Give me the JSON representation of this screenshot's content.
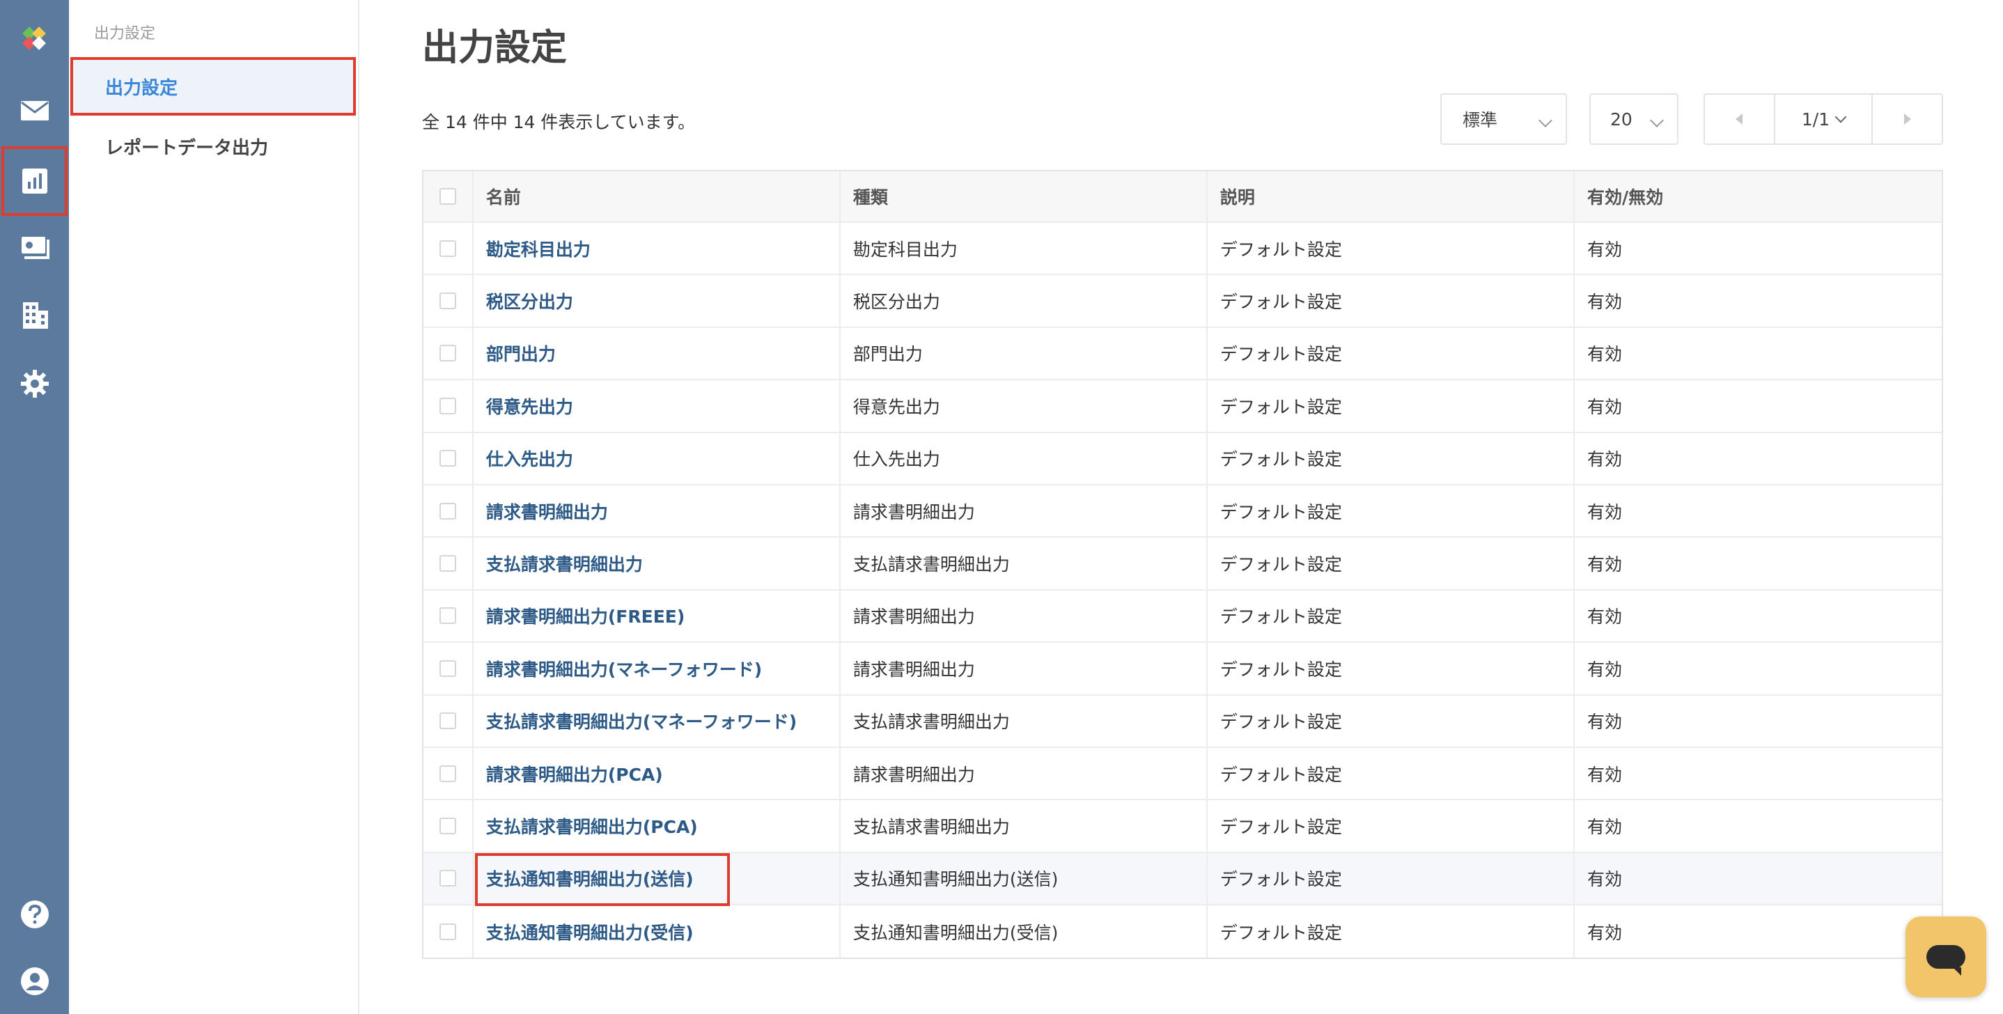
{
  "colors": {
    "rail": "#5b7a9d",
    "accent": "#3a86d8",
    "highlight_border": "#e03c2e",
    "link": "#2d5a86",
    "chat": "#f3c56a"
  },
  "rail": {
    "items": [
      {
        "name": "logo",
        "icon": "app-logo-icon"
      },
      {
        "name": "mail",
        "icon": "mail-icon"
      },
      {
        "name": "reports",
        "icon": "chart-icon",
        "selected": true
      },
      {
        "name": "documents",
        "icon": "document-icon"
      },
      {
        "name": "company",
        "icon": "building-icon"
      },
      {
        "name": "settings",
        "icon": "gear-icon"
      },
      {
        "name": "help",
        "icon": "help-icon"
      },
      {
        "name": "account",
        "icon": "user-icon"
      }
    ]
  },
  "subnav": {
    "title": "出力設定",
    "items": [
      {
        "label": "出力設定",
        "active": true
      },
      {
        "label": "レポートデータ出力",
        "active": false
      }
    ]
  },
  "main": {
    "title": "出力設定",
    "count_text": "全 14 件中 14 件表示しています。",
    "view_select": "標準",
    "per_page_select": "20",
    "pager_label": "1/1"
  },
  "table": {
    "headers": [
      "名前",
      "種類",
      "説明",
      "有効/無効"
    ],
    "rows": [
      {
        "name": "勘定科目出力",
        "type": "勘定科目出力",
        "desc": "デフォルト設定",
        "status": "有効"
      },
      {
        "name": "税区分出力",
        "type": "税区分出力",
        "desc": "デフォルト設定",
        "status": "有効"
      },
      {
        "name": "部門出力",
        "type": "部門出力",
        "desc": "デフォルト設定",
        "status": "有効"
      },
      {
        "name": "得意先出力",
        "type": "得意先出力",
        "desc": "デフォルト設定",
        "status": "有効"
      },
      {
        "name": "仕入先出力",
        "type": "仕入先出力",
        "desc": "デフォルト設定",
        "status": "有効"
      },
      {
        "name": "請求書明細出力",
        "type": "請求書明細出力",
        "desc": "デフォルト設定",
        "status": "有効"
      },
      {
        "name": "支払請求書明細出力",
        "type": "支払請求書明細出力",
        "desc": "デフォルト設定",
        "status": "有効"
      },
      {
        "name": "請求書明細出力(FREEE)",
        "type": "請求書明細出力",
        "desc": "デフォルト設定",
        "status": "有効"
      },
      {
        "name": "請求書明細出力(マネーフォワード)",
        "type": "請求書明細出力",
        "desc": "デフォルト設定",
        "status": "有効"
      },
      {
        "name": "支払請求書明細出力(マネーフォワード)",
        "type": "支払請求書明細出力",
        "desc": "デフォルト設定",
        "status": "有効"
      },
      {
        "name": "請求書明細出力(PCA)",
        "type": "請求書明細出力",
        "desc": "デフォルト設定",
        "status": "有効"
      },
      {
        "name": "支払請求書明細出力(PCA)",
        "type": "支払請求書明細出力",
        "desc": "デフォルト設定",
        "status": "有効"
      },
      {
        "name": "支払通知書明細出力(送信)",
        "type": "支払通知書明細出力(送信)",
        "desc": "デフォルト設定",
        "status": "有効",
        "highlighted": true
      },
      {
        "name": "支払通知書明細出力(受信)",
        "type": "支払通知書明細出力(受信)",
        "desc": "デフォルト設定",
        "status": "有効"
      }
    ]
  },
  "chat": {
    "icon": "chat-icon"
  }
}
